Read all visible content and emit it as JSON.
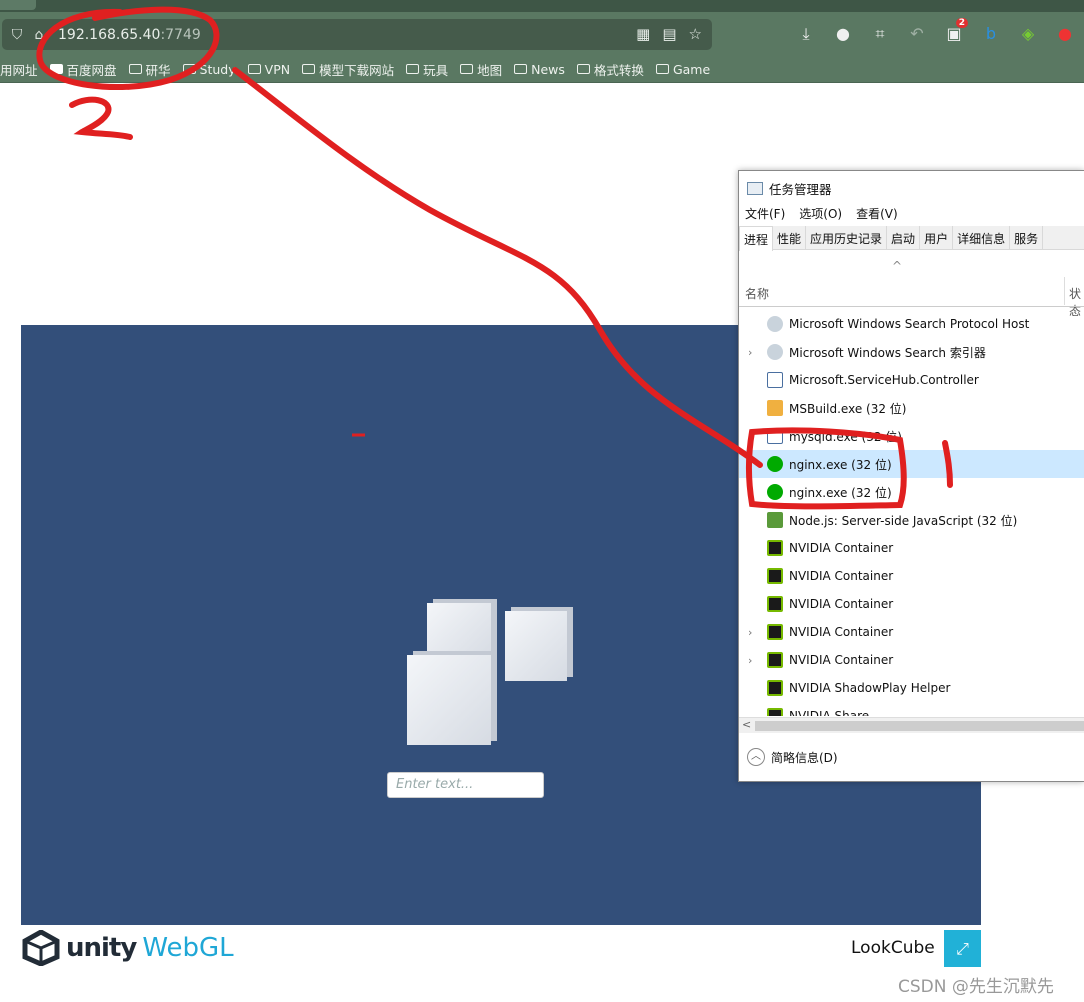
{
  "browser": {
    "address": {
      "host": "192.168.65.40",
      "port": ":7749"
    },
    "address_icons": [
      "shield-icon",
      "lock-icon",
      "qr-code-icon",
      "network-icon",
      "star-icon"
    ],
    "toolbar_icons": [
      "download-icon",
      "extension-icon",
      "crop-icon",
      "undo-icon",
      "extension-badge-icon",
      "bing-icon",
      "globe-icon",
      "extension-icon"
    ],
    "badge_count": "2",
    "bookmarks": [
      "用网址",
      "百度网盘",
      "研华",
      "Study",
      "VPN",
      "模型下载网站",
      "玩具",
      "地图",
      "News",
      "格式转换",
      "Game"
    ]
  },
  "webgl": {
    "input_placeholder": "Enter text...",
    "canvas_color": "#334f7a",
    "logo_unity": "unity",
    "logo_webgl": "WebGL",
    "title": "LookCube",
    "fullscreen_icon": "fullscreen-icon"
  },
  "task_manager": {
    "title": "任务管理器",
    "menu": [
      "文件(F)",
      "选项(O)",
      "查看(V)"
    ],
    "tabs": [
      "进程",
      "性能",
      "应用历史记录",
      "启动",
      "用户",
      "详细信息",
      "服务"
    ],
    "col_name": "名称",
    "col_status": "状态",
    "rows": [
      {
        "name": "Microsoft Windows Search Protocol Host",
        "icon": "user-icon",
        "expand": false
      },
      {
        "name": "Microsoft Windows Search 索引器",
        "icon": "user-icon",
        "expand": true
      },
      {
        "name": "Microsoft.ServiceHub.Controller",
        "icon": "window-icon",
        "expand": false
      },
      {
        "name": "MSBuild.exe (32 位)",
        "icon": "msbuild-icon",
        "expand": false
      },
      {
        "name": "mysqld.exe (32 位)",
        "icon": "window-icon",
        "expand": false
      },
      {
        "name": "nginx.exe (32 位)",
        "icon": "nginx-icon",
        "expand": false,
        "selected": true
      },
      {
        "name": "nginx.exe (32 位)",
        "icon": "nginx-icon",
        "expand": false
      },
      {
        "name": "Node.js: Server-side JavaScript (32 位)",
        "icon": "nodejs-icon",
        "expand": false
      },
      {
        "name": "NVIDIA Container",
        "icon": "nvidia-icon",
        "expand": false
      },
      {
        "name": "NVIDIA Container",
        "icon": "nvidia-icon",
        "expand": false
      },
      {
        "name": "NVIDIA Container",
        "icon": "nvidia-icon",
        "expand": false
      },
      {
        "name": "NVIDIA Container",
        "icon": "nvidia-icon",
        "expand": true
      },
      {
        "name": "NVIDIA Container",
        "icon": "nvidia-icon",
        "expand": true
      },
      {
        "name": "NVIDIA ShadowPlay Helper",
        "icon": "nvidia-icon",
        "expand": false
      },
      {
        "name": "NVIDIA Share",
        "icon": "nvidia-icon",
        "expand": false
      }
    ],
    "footer": "简略信息(D)"
  },
  "annotations": {
    "label_1": "1",
    "label_2": "2",
    "color": "#e02020"
  },
  "watermark": "CSDN @先生沉默先"
}
